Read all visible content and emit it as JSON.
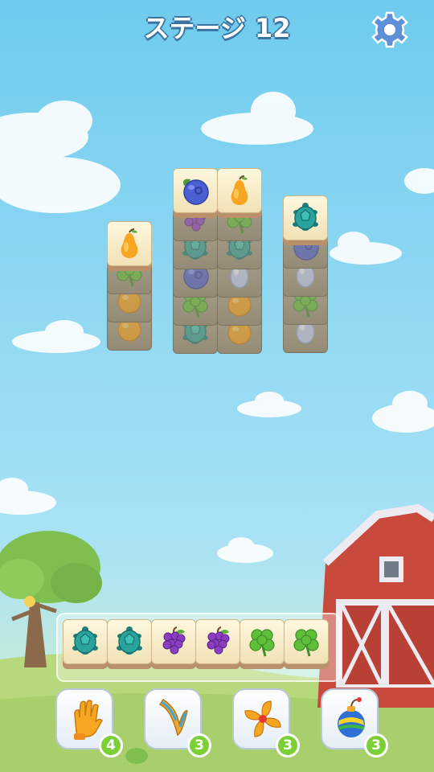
{
  "header": {
    "title": "ステージ 12",
    "settings_icon": "gear-icon"
  },
  "board": {
    "columns": [
      {
        "name": "column-1",
        "visible_top": "pear",
        "hidden_below": [
          "clover",
          "orange",
          "orange"
        ]
      },
      {
        "name": "column-2",
        "visible_top": "blueberry",
        "hidden_below": [
          "grapes",
          "turtle",
          "blueberry",
          "clover",
          "turtle"
        ]
      },
      {
        "name": "column-3",
        "visible_top": "pear",
        "hidden_below": [
          "clover",
          "turtle",
          "egg",
          "orange",
          "orange"
        ]
      },
      {
        "name": "column-4",
        "visible_top": "turtle",
        "hidden_below": [
          "blueberry",
          "egg",
          "clover",
          "egg"
        ]
      }
    ]
  },
  "tray": {
    "slots": [
      "turtle",
      "turtle",
      "grapes",
      "grapes",
      "clover",
      "clover"
    ]
  },
  "powerups": [
    {
      "name": "glove",
      "icon": "glove-icon",
      "count": "4"
    },
    {
      "name": "boomerang",
      "icon": "boomerang-icon",
      "count": "3"
    },
    {
      "name": "fan",
      "icon": "fan-icon",
      "count": "3"
    },
    {
      "name": "bomb",
      "icon": "bomb-icon",
      "count": "3"
    }
  ],
  "colors": {
    "sky": "#7ad0ef",
    "grass": "#b7d97c",
    "barn": "#c74a3c",
    "badge": "#7dcf38"
  }
}
